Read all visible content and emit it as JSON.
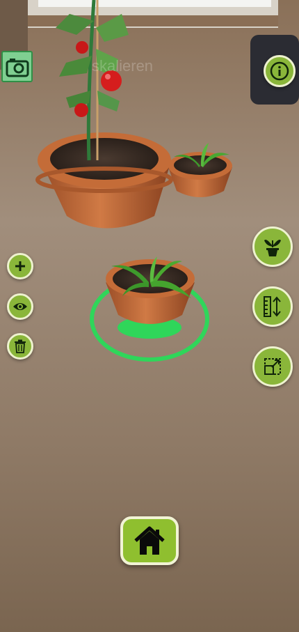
{
  "overlay": {
    "faded_text": "skalieren"
  },
  "icons": {
    "camera": "camera-icon",
    "info": "info-icon",
    "add": "plus-icon",
    "view": "eye-icon",
    "delete": "trash-icon",
    "plant": "potted-plant-icon",
    "measure": "height-ruler-icon",
    "scale": "resize-icon",
    "home": "home-icon"
  },
  "colors": {
    "button_green": "#8ab63a",
    "selection_ring": "#2fd65a",
    "camera_bg": "#7fcf91",
    "floor": "#9a8773"
  }
}
